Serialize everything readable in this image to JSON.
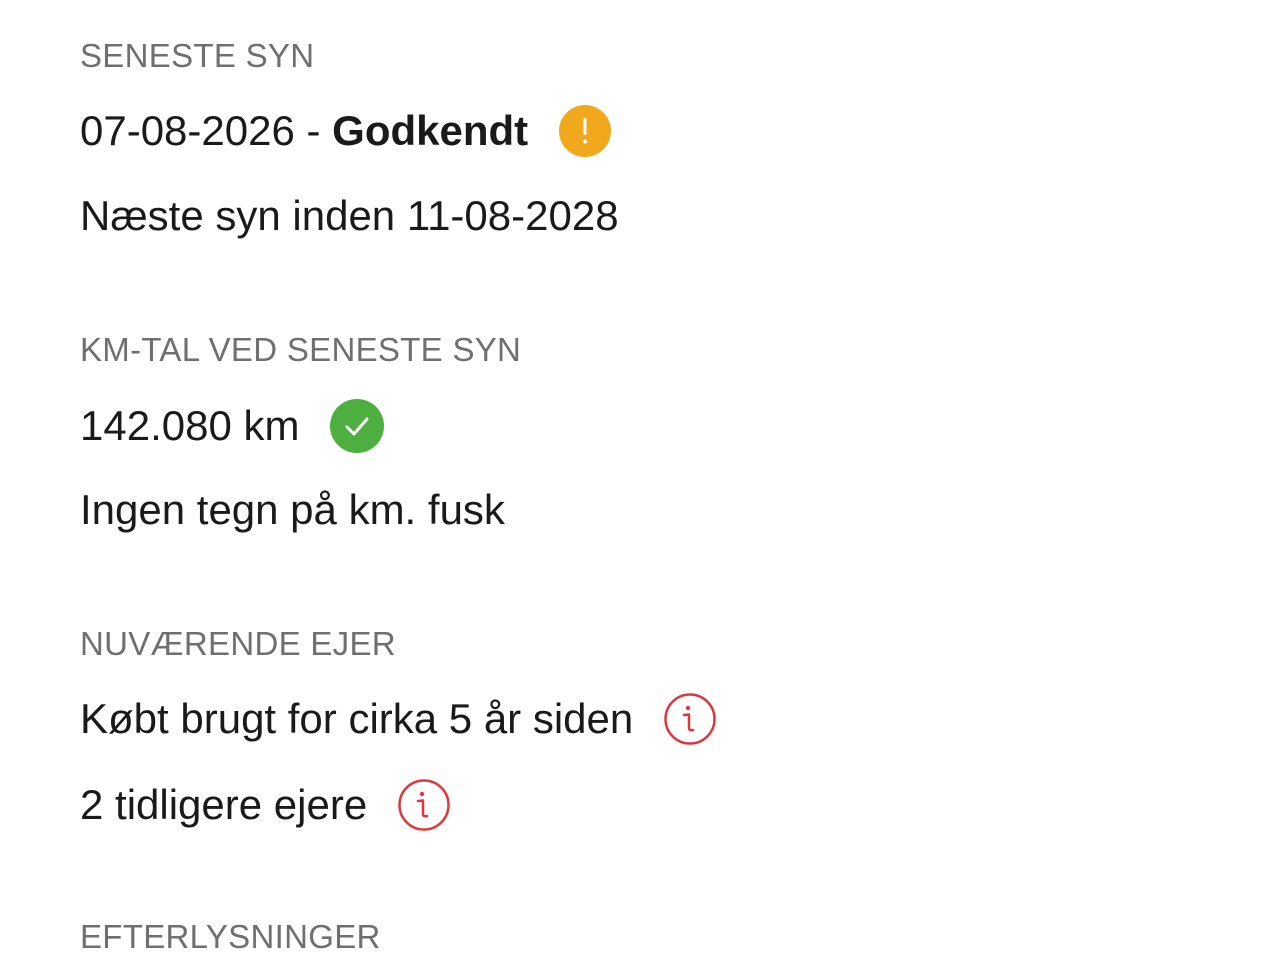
{
  "inspection": {
    "label": "SENESTE SYN",
    "date": "07-08-2026",
    "separator": " - ",
    "status": "Godkendt",
    "status_icon": "warning-icon",
    "status_icon_color": "#F2A81D",
    "next": "Næste syn inden 11-08-2028"
  },
  "mileage": {
    "label": "KM-TAL VED SENESTE SYN",
    "value": "142.080 km",
    "value_icon": "check-icon",
    "value_icon_color": "#4CAF3F",
    "note": "Ingen tegn på km. fusk"
  },
  "owner": {
    "label": "NUVÆRENDE EJER",
    "purchased": "Købt brugt for cirka 5 år siden",
    "purchased_icon": "info-icon",
    "previous": "2 tidligere ejere",
    "previous_icon": "info-icon",
    "info_icon_color": "#E0363B"
  },
  "alerts": {
    "label": "EFTERLYSNINGER"
  }
}
